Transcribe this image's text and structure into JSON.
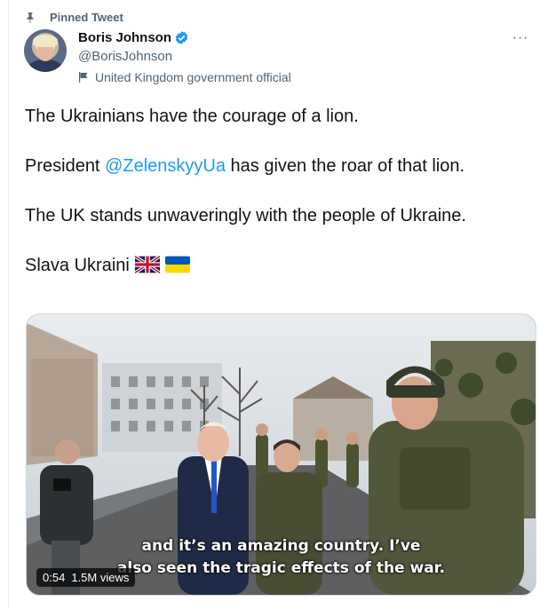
{
  "pinned": {
    "label": "Pinned Tweet",
    "icon": "pin-icon"
  },
  "author": {
    "name": "Boris Johnson",
    "handle": "@BorisJohnson",
    "affiliation": "United Kingdom government official",
    "verified_color": "#1d9bf0"
  },
  "tweet": {
    "line1": "The Ukrainians have the courage of a lion.",
    "line2_pre": "President ",
    "line2_mention": "@ZelenskyyUa",
    "line2_post": " has given the roar of that lion.",
    "line3": "The UK stands unwaveringly with the people of Ukraine.",
    "line4": "Slava Ukraini",
    "emoji": [
      "uk-flag",
      "ukraine-flag"
    ],
    "mention_color": "#1d9bf0"
  },
  "video": {
    "caption_line1": "and it’s an amazing country. I’ve",
    "caption_line2": "also seen the tragic effects of the war.",
    "duration": "0:54",
    "views": "1.5M views"
  },
  "menu": {
    "icon": "more-options-icon",
    "glyph": "···"
  }
}
